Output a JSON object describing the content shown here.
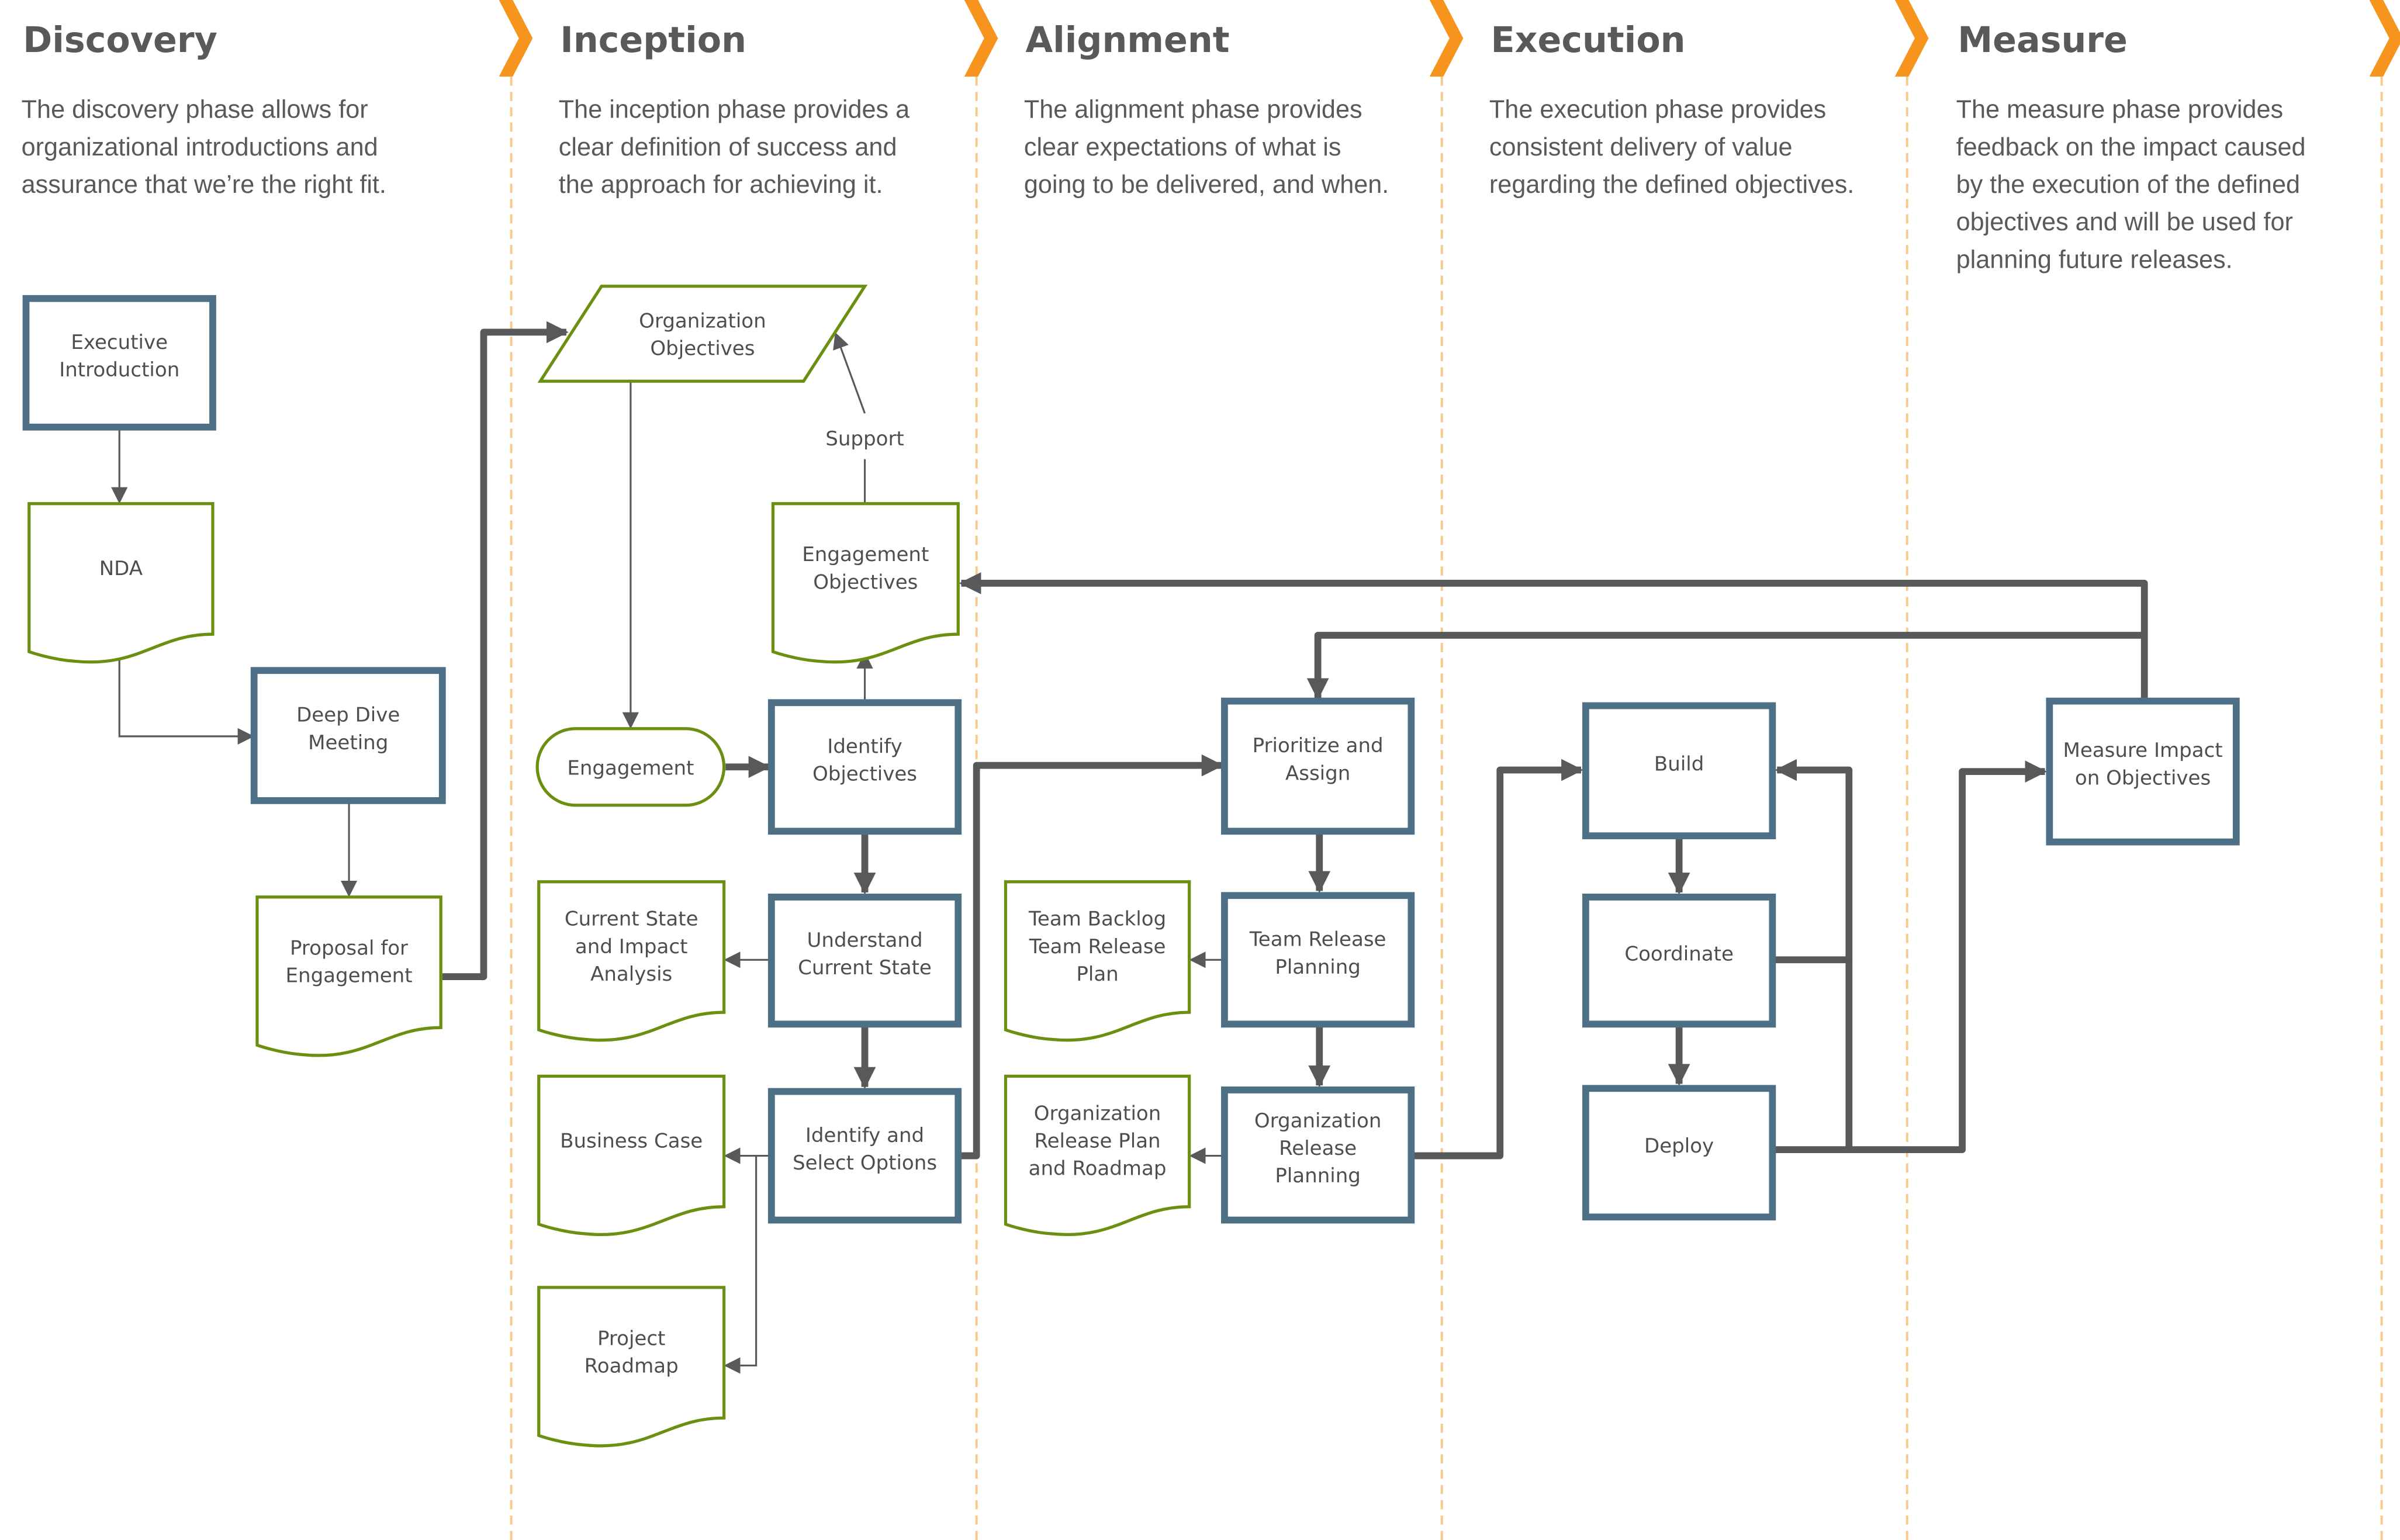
{
  "colors": {
    "accent_orange": "#f7941d",
    "divider": "#f7c98a",
    "process_border": "#4e7087",
    "artifact_border": "#6a8f11",
    "connector": "#58595b",
    "text": "#58595b"
  },
  "phases": [
    {
      "id": "discovery",
      "title": "Discovery",
      "description": [
        "The discovery phase allows for",
        "organizational introductions and",
        "assurance that we’re the right fit."
      ]
    },
    {
      "id": "inception",
      "title": "Inception",
      "description": [
        "The inception phase provides a",
        "clear definition of success and",
        "the approach for achieving it."
      ]
    },
    {
      "id": "alignment",
      "title": "Alignment",
      "description": [
        "The alignment phase provides",
        "clear expectations of what is",
        "going to be delivered, and when."
      ]
    },
    {
      "id": "execution",
      "title": "Execution",
      "description": [
        "The execution phase provides",
        "consistent delivery of value",
        "regarding the defined objectives."
      ]
    },
    {
      "id": "measure",
      "title": "Measure",
      "description": [
        "The measure phase provides",
        "feedback on the impact caused",
        "by the execution of the defined",
        "objectives and will be used for",
        "planning future releases."
      ]
    }
  ],
  "nodes": [
    {
      "id": "executive-introduction",
      "type": "process",
      "phase": "discovery",
      "label": [
        "Executive",
        "Introduction"
      ]
    },
    {
      "id": "nda",
      "type": "document",
      "phase": "discovery",
      "label": [
        "NDA"
      ]
    },
    {
      "id": "deep-dive-meeting",
      "type": "process",
      "phase": "discovery",
      "label": [
        "Deep Dive",
        "Meeting"
      ]
    },
    {
      "id": "proposal-for-engagement",
      "type": "document",
      "phase": "discovery",
      "label": [
        "Proposal for",
        "Engagement"
      ]
    },
    {
      "id": "organization-objectives",
      "type": "data",
      "phase": "inception",
      "label": [
        "Organization",
        "Objectives"
      ]
    },
    {
      "id": "engagement-objectives",
      "type": "document",
      "phase": "inception",
      "label": [
        "Engagement",
        "Objectives"
      ]
    },
    {
      "id": "engagement",
      "type": "terminator",
      "phase": "inception",
      "label": [
        "Engagement"
      ]
    },
    {
      "id": "identify-objectives",
      "type": "process",
      "phase": "inception",
      "label": [
        "Identify",
        "Objectives"
      ]
    },
    {
      "id": "current-state-impact-analysis",
      "type": "document",
      "phase": "inception",
      "label": [
        "Current State",
        "and Impact",
        "Analysis"
      ]
    },
    {
      "id": "understand-current-state",
      "type": "process",
      "phase": "inception",
      "label": [
        "Understand",
        "Current State"
      ]
    },
    {
      "id": "business-case",
      "type": "document",
      "phase": "inception",
      "label": [
        "Business Case"
      ]
    },
    {
      "id": "identify-select-options",
      "type": "process",
      "phase": "inception",
      "label": [
        "Identify and",
        "Select Options"
      ]
    },
    {
      "id": "project-roadmap",
      "type": "document",
      "phase": "inception",
      "label": [
        "Project",
        "Roadmap"
      ]
    },
    {
      "id": "prioritize-assign",
      "type": "process",
      "phase": "alignment",
      "label": [
        "Prioritize and",
        "Assign"
      ]
    },
    {
      "id": "team-backlog-release-plan",
      "type": "document",
      "phase": "alignment",
      "label": [
        "Team Backlog",
        "Team Release",
        "Plan"
      ]
    },
    {
      "id": "team-release-planning",
      "type": "process",
      "phase": "alignment",
      "label": [
        "Team Release",
        "Planning"
      ]
    },
    {
      "id": "org-release-plan-roadmap",
      "type": "document",
      "phase": "alignment",
      "label": [
        "Organization",
        "Release Plan",
        "and Roadmap"
      ]
    },
    {
      "id": "org-release-planning",
      "type": "process",
      "phase": "alignment",
      "label": [
        "Organization",
        "Release",
        "Planning"
      ]
    },
    {
      "id": "build",
      "type": "process",
      "phase": "execution",
      "label": [
        "Build"
      ]
    },
    {
      "id": "coordinate",
      "type": "process",
      "phase": "execution",
      "label": [
        "Coordinate"
      ]
    },
    {
      "id": "deploy",
      "type": "process",
      "phase": "execution",
      "label": [
        "Deploy"
      ]
    },
    {
      "id": "measure-impact",
      "type": "process",
      "phase": "measure",
      "label": [
        "Measure Impact",
        "on Objectives"
      ]
    }
  ],
  "edges": [
    {
      "from": "executive-introduction",
      "to": "nda",
      "weight": "thin"
    },
    {
      "from": "nda",
      "to": "deep-dive-meeting",
      "weight": "thin"
    },
    {
      "from": "deep-dive-meeting",
      "to": "proposal-for-engagement",
      "weight": "thin"
    },
    {
      "from": "proposal-for-engagement",
      "to": "organization-objectives",
      "weight": "thick"
    },
    {
      "from": "organization-objectives",
      "to": "engagement",
      "weight": "thin"
    },
    {
      "from": "engagement-objectives",
      "to": "organization-objectives",
      "weight": "thin",
      "label": "Support"
    },
    {
      "from": "engagement",
      "to": "identify-objectives",
      "weight": "thick"
    },
    {
      "from": "identify-objectives",
      "to": "engagement-objectives",
      "weight": "thin"
    },
    {
      "from": "identify-objectives",
      "to": "understand-current-state",
      "weight": "thick"
    },
    {
      "from": "understand-current-state",
      "to": "current-state-impact-analysis",
      "weight": "thin"
    },
    {
      "from": "understand-current-state",
      "to": "identify-select-options",
      "weight": "thick"
    },
    {
      "from": "identify-select-options",
      "to": "business-case",
      "weight": "thin"
    },
    {
      "from": "identify-select-options",
      "to": "project-roadmap",
      "weight": "thin"
    },
    {
      "from": "identify-select-options",
      "to": "prioritize-assign",
      "weight": "thick"
    },
    {
      "from": "prioritize-assign",
      "to": "team-release-planning",
      "weight": "thick"
    },
    {
      "from": "team-release-planning",
      "to": "team-backlog-release-plan",
      "weight": "thin"
    },
    {
      "from": "team-release-planning",
      "to": "org-release-planning",
      "weight": "thick"
    },
    {
      "from": "org-release-planning",
      "to": "org-release-plan-roadmap",
      "weight": "thin"
    },
    {
      "from": "org-release-planning",
      "to": "build",
      "weight": "thick"
    },
    {
      "from": "build",
      "to": "coordinate",
      "weight": "thick"
    },
    {
      "from": "coordinate",
      "to": "deploy",
      "weight": "thick"
    },
    {
      "from": "coordinate",
      "to": "build",
      "weight": "thick"
    },
    {
      "from": "deploy",
      "to": "build",
      "weight": "thick"
    },
    {
      "from": "deploy",
      "to": "measure-impact",
      "weight": "thick"
    },
    {
      "from": "measure-impact",
      "to": "engagement-objectives",
      "weight": "thick"
    },
    {
      "from": "measure-impact",
      "to": "prioritize-assign",
      "weight": "thick"
    }
  ]
}
